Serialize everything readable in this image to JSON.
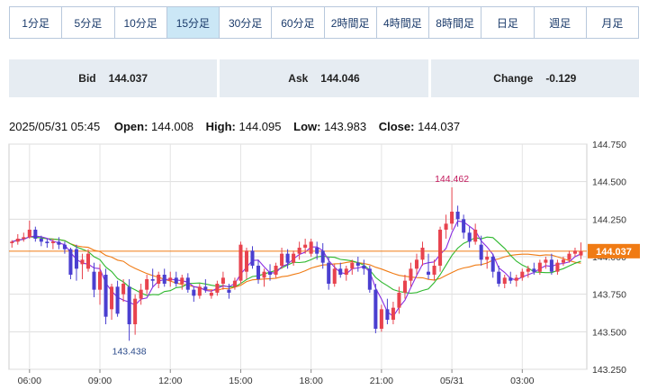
{
  "timeframes": [
    {
      "label": "1分足",
      "active": false
    },
    {
      "label": "5分足",
      "active": false
    },
    {
      "label": "10分足",
      "active": false
    },
    {
      "label": "15分足",
      "active": true
    },
    {
      "label": "30分足",
      "active": false
    },
    {
      "label": "60分足",
      "active": false
    },
    {
      "label": "2時間足",
      "active": false
    },
    {
      "label": "4時間足",
      "active": false
    },
    {
      "label": "8時間足",
      "active": false
    },
    {
      "label": "日足",
      "active": false
    },
    {
      "label": "週足",
      "active": false
    },
    {
      "label": "月足",
      "active": false
    }
  ],
  "quote": {
    "bid_label": "Bid",
    "bid_value": "144.037",
    "ask_label": "Ask",
    "ask_value": "144.046",
    "change_label": "Change",
    "change_value": "-0.129"
  },
  "ohlc": {
    "datetime": "2025/05/31 05:45",
    "open_label": "Open:",
    "open_value": "144.008",
    "high_label": "High:",
    "high_value": "144.095",
    "low_label": "Low:",
    "low_value": "143.983",
    "close_label": "Close:",
    "close_value": "144.037"
  },
  "colors": {
    "up": "#e8434e",
    "down": "#4a3fd0",
    "ma_fast": "#8a2be2",
    "ma_mid": "#2eb82e",
    "ma_slow": "#f07b14",
    "price_line": "#f07b14",
    "high_label": "#c2185b",
    "low_label": "#2a4a8a"
  },
  "chart_data": {
    "type": "candlestick",
    "ylim": [
      143.25,
      144.75
    ],
    "y_ticks": [
      "144.750",
      "144.500",
      "144.250",
      "144.000",
      "143.750",
      "143.500",
      "143.250"
    ],
    "x_ticks": [
      {
        "label": "06:00",
        "index": 3
      },
      {
        "label": "09:00",
        "index": 15
      },
      {
        "label": "12:00",
        "index": 27
      },
      {
        "label": "15:00",
        "index": 39
      },
      {
        "label": "18:00",
        "index": 51
      },
      {
        "label": "21:00",
        "index": 63
      },
      {
        "label": "05/31",
        "index": 75
      },
      {
        "label": "03:00",
        "index": 87
      }
    ],
    "annotations": [
      {
        "text": "144.462",
        "index": 75,
        "value": 144.462,
        "type": "high"
      },
      {
        "text": "143.438",
        "index": 20,
        "value": 143.438,
        "type": "low"
      }
    ],
    "current_price": "144.037",
    "candles": [
      [
        144.09,
        144.11,
        144.06,
        144.1
      ],
      [
        144.1,
        144.15,
        144.08,
        144.12
      ],
      [
        144.12,
        144.16,
        144.1,
        144.13
      ],
      [
        144.13,
        144.24,
        144.12,
        144.18
      ],
      [
        144.18,
        144.2,
        144.1,
        144.12
      ],
      [
        144.12,
        144.14,
        144.07,
        144.1
      ],
      [
        144.1,
        144.12,
        144.06,
        144.09
      ],
      [
        144.09,
        144.12,
        144.05,
        144.1
      ],
      [
        144.1,
        144.13,
        144.05,
        144.08
      ],
      [
        144.08,
        144.1,
        144.02,
        144.05
      ],
      [
        144.05,
        144.06,
        143.85,
        143.88
      ],
      [
        144.05,
        144.08,
        143.84,
        143.92
      ],
      [
        143.95,
        144.02,
        143.85,
        143.98
      ],
      [
        143.92,
        144.05,
        143.9,
        144.02
      ],
      [
        143.9,
        143.96,
        143.73,
        143.78
      ],
      [
        143.78,
        143.95,
        143.68,
        143.9
      ],
      [
        143.88,
        143.92,
        143.55,
        143.6
      ],
      [
        143.65,
        143.82,
        143.58,
        143.8
      ],
      [
        143.8,
        143.84,
        143.6,
        143.62
      ],
      [
        143.75,
        143.85,
        143.7,
        143.82
      ],
      [
        143.8,
        143.85,
        143.44,
        143.55
      ],
      [
        143.55,
        143.75,
        143.48,
        143.72
      ],
      [
        143.72,
        143.82,
        143.68,
        143.78
      ],
      [
        143.78,
        143.88,
        143.75,
        143.85
      ],
      [
        143.85,
        143.92,
        143.8,
        143.84
      ],
      [
        143.82,
        143.9,
        143.79,
        143.88
      ],
      [
        143.88,
        143.92,
        143.8,
        143.82
      ],
      [
        143.84,
        143.9,
        143.8,
        143.86
      ],
      [
        143.86,
        143.9,
        143.8,
        143.82
      ],
      [
        143.82,
        143.88,
        143.78,
        143.86
      ],
      [
        143.86,
        143.89,
        143.76,
        143.78
      ],
      [
        143.78,
        143.8,
        143.7,
        143.74
      ],
      [
        143.74,
        143.82,
        143.72,
        143.8
      ],
      [
        143.8,
        143.85,
        143.76,
        143.78
      ],
      [
        143.74,
        143.78,
        143.72,
        143.76
      ],
      [
        143.76,
        143.84,
        143.74,
        143.82
      ],
      [
        143.82,
        143.9,
        143.78,
        143.86
      ],
      [
        143.78,
        143.82,
        143.72,
        143.76
      ],
      [
        143.8,
        143.86,
        143.78,
        143.84
      ],
      [
        143.84,
        144.1,
        143.82,
        144.08
      ],
      [
        143.9,
        144.06,
        143.85,
        144.04
      ],
      [
        144.04,
        144.07,
        143.92,
        143.94
      ],
      [
        143.94,
        143.98,
        143.82,
        143.85
      ],
      [
        143.86,
        143.92,
        143.8,
        143.9
      ],
      [
        143.9,
        143.95,
        143.84,
        143.88
      ],
      [
        143.88,
        143.96,
        143.86,
        143.94
      ],
      [
        143.94,
        144.06,
        143.92,
        144.02
      ],
      [
        144.02,
        144.05,
        143.92,
        143.96
      ],
      [
        143.96,
        144.04,
        143.94,
        144.02
      ],
      [
        144.02,
        144.1,
        143.98,
        144.06
      ],
      [
        144.06,
        144.12,
        144.02,
        144.08
      ],
      [
        144.02,
        144.12,
        144.0,
        144.1
      ],
      [
        144.06,
        144.1,
        143.98,
        144.02
      ],
      [
        144.04,
        144.09,
        143.92,
        143.96
      ],
      [
        143.96,
        144.0,
        143.78,
        143.82
      ],
      [
        143.82,
        143.95,
        143.8,
        143.92
      ],
      [
        143.92,
        143.96,
        143.86,
        143.88
      ],
      [
        143.88,
        143.94,
        143.84,
        143.92
      ],
      [
        143.92,
        143.98,
        143.88,
        143.96
      ],
      [
        143.96,
        144.0,
        143.9,
        143.94
      ],
      [
        143.94,
        143.98,
        143.88,
        143.92
      ],
      [
        143.92,
        143.94,
        143.76,
        143.78
      ],
      [
        143.78,
        143.82,
        143.49,
        143.52
      ],
      [
        143.52,
        143.68,
        143.5,
        143.65
      ],
      [
        143.65,
        143.72,
        143.55,
        143.58
      ],
      [
        143.58,
        143.7,
        143.55,
        143.66
      ],
      [
        143.66,
        143.8,
        143.62,
        143.76
      ],
      [
        143.76,
        143.88,
        143.72,
        143.84
      ],
      [
        143.84,
        143.96,
        143.8,
        143.92
      ],
      [
        143.92,
        144.02,
        143.88,
        143.98
      ],
      [
        143.98,
        144.1,
        143.94,
        144.06
      ],
      [
        143.9,
        144.02,
        143.85,
        143.88
      ],
      [
        143.88,
        143.98,
        143.84,
        143.94
      ],
      [
        143.94,
        144.2,
        143.9,
        144.18
      ],
      [
        144.18,
        144.28,
        144.12,
        144.22
      ],
      [
        144.22,
        144.462,
        144.18,
        144.3
      ],
      [
        144.3,
        144.34,
        144.2,
        144.25
      ],
      [
        144.25,
        144.28,
        144.12,
        144.16
      ],
      [
        144.16,
        144.2,
        144.06,
        144.1
      ],
      [
        144.1,
        144.22,
        144.08,
        144.18
      ],
      [
        144.08,
        144.14,
        143.94,
        143.98
      ],
      [
        143.98,
        144.04,
        143.92,
        144.0
      ],
      [
        144.0,
        144.02,
        143.86,
        143.9
      ],
      [
        143.9,
        143.94,
        143.8,
        143.82
      ],
      [
        143.82,
        143.88,
        143.79,
        143.86
      ],
      [
        143.86,
        143.9,
        143.82,
        143.84
      ],
      [
        143.84,
        143.88,
        143.8,
        143.86
      ],
      [
        143.86,
        143.92,
        143.84,
        143.9
      ],
      [
        143.9,
        143.94,
        143.86,
        143.92
      ],
      [
        143.92,
        143.96,
        143.88,
        143.9
      ],
      [
        143.9,
        143.98,
        143.88,
        143.96
      ],
      [
        143.96,
        144.0,
        143.92,
        143.98
      ],
      [
        143.98,
        144.02,
        143.88,
        143.9
      ],
      [
        143.9,
        143.98,
        143.88,
        143.96
      ],
      [
        143.96,
        144.0,
        143.94,
        143.98
      ],
      [
        143.98,
        144.04,
        143.96,
        144.02
      ],
      [
        144.02,
        144.06,
        144.0,
        144.04
      ],
      [
        144.008,
        144.095,
        143.983,
        144.037
      ]
    ]
  }
}
